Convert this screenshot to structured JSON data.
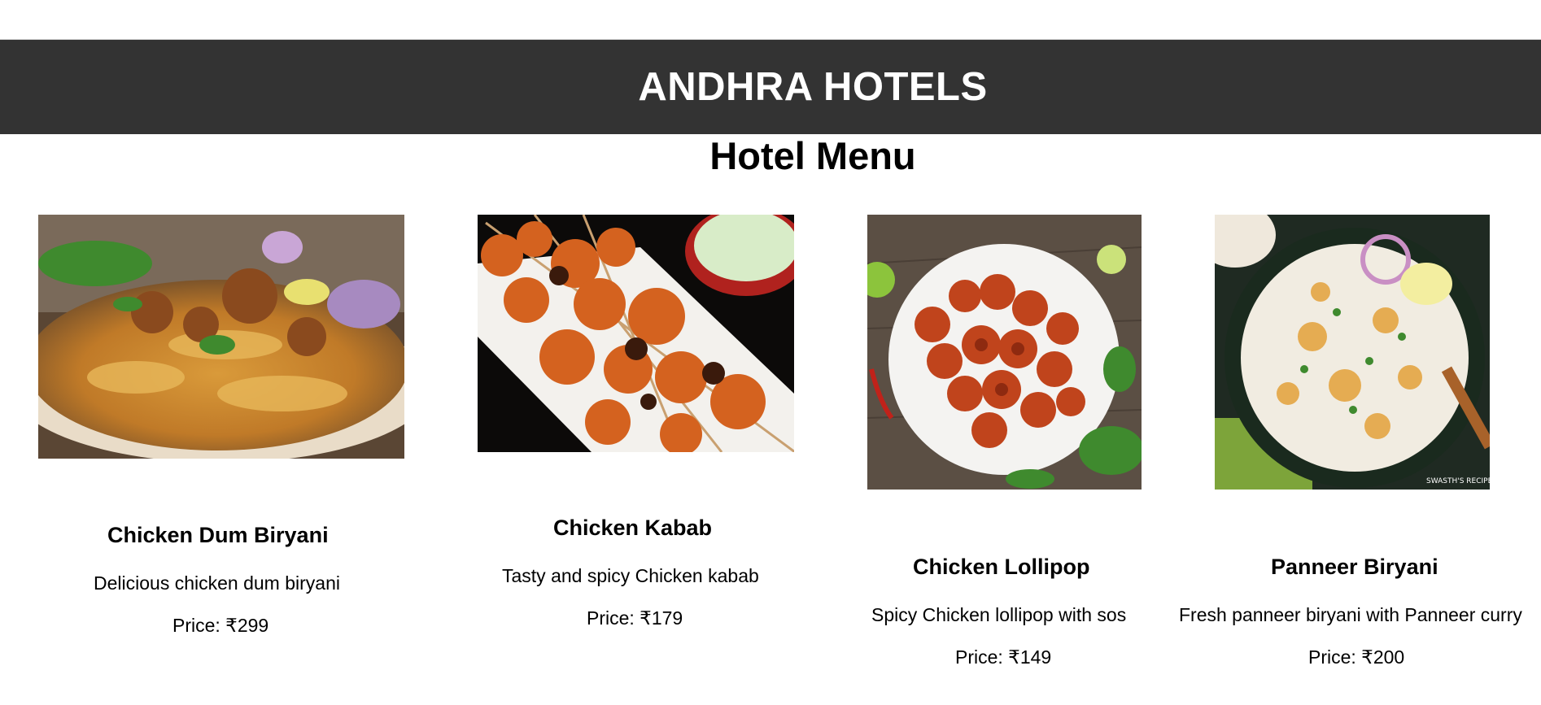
{
  "header": {
    "title": "ANDHRA HOTELS"
  },
  "page": {
    "title": "Hotel Menu"
  },
  "items": [
    {
      "name": "Chicken Dum Biryani",
      "description": "Delicious chicken dum biryani",
      "price_label": "Price: ₹299",
      "image_icon": "biryani-photo"
    },
    {
      "name": "Chicken Kabab",
      "description": "Tasty and spicy Chicken kabab",
      "price_label": "Price: ₹179",
      "image_icon": "kabab-photo"
    },
    {
      "name": "Chicken Lollipop",
      "description": "Spicy Chicken lollipop with sos",
      "price_label": "Price: ₹149",
      "image_icon": "lollipop-photo"
    },
    {
      "name": "Panneer Biryani",
      "description": "Fresh panneer biryani with Panneer curry",
      "price_label": "Price: ₹200",
      "image_icon": "panneer-biryani-photo"
    }
  ],
  "colors": {
    "header_bg": "#333333",
    "header_text": "#ffffff",
    "page_bg": "#ffffff",
    "text": "#000000"
  }
}
